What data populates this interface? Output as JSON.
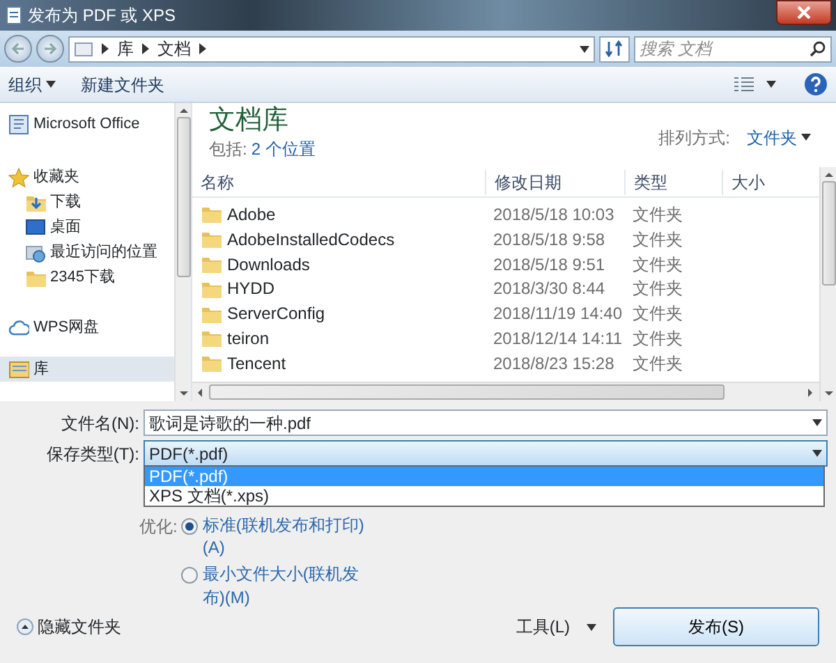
{
  "window": {
    "title": "发布为 PDF 或 XPS"
  },
  "address": {
    "breadcrumb": [
      "库",
      "文档"
    ]
  },
  "search": {
    "placeholder": "搜索 文档"
  },
  "toolbar": {
    "organize": "组织",
    "new_folder": "新建文件夹"
  },
  "nav": [
    {
      "label": "Microsoft Office",
      "kind": "office",
      "selected": false
    },
    {
      "label": "收藏夹",
      "kind": "favorites",
      "selected": false,
      "children": [
        {
          "label": "下载",
          "kind": "download",
          "selected": false
        },
        {
          "label": "桌面",
          "kind": "desktop",
          "selected": false
        },
        {
          "label": "最近访问的位置",
          "kind": "recent",
          "selected": false
        },
        {
          "label": "2345下载",
          "kind": "folder",
          "selected": false
        }
      ]
    },
    {
      "label": "WPS网盘",
      "kind": "cloud",
      "selected": false
    },
    {
      "label": "库",
      "kind": "library",
      "selected": true
    }
  ],
  "library": {
    "title": "文档库",
    "includes_label": "包括:",
    "includes_link": "2 个位置",
    "arrange_label": "排列方式:",
    "arrange_value": "文件夹"
  },
  "table": {
    "columns": [
      "名称",
      "修改日期",
      "类型",
      "大小"
    ],
    "rows": [
      {
        "name": "Adobe",
        "date": "2018/5/18 10:03",
        "type": "文件夹"
      },
      {
        "name": "AdobeInstalledCodecs",
        "date": "2018/5/18 9:58",
        "type": "文件夹"
      },
      {
        "name": "Downloads",
        "date": "2018/5/18 9:51",
        "type": "文件夹"
      },
      {
        "name": "HYDD",
        "date": "2018/3/30 8:44",
        "type": "文件夹"
      },
      {
        "name": "ServerConfig",
        "date": "2018/11/19 14:40",
        "type": "文件夹"
      },
      {
        "name": "teiron",
        "date": "2018/12/14 14:11",
        "type": "文件夹"
      },
      {
        "name": "Tencent",
        "date": "2018/8/23 15:28",
        "type": "文件夹"
      }
    ]
  },
  "form": {
    "filename_label": "文件名(N):",
    "filename": "歌词是诗歌的一种.pdf",
    "type_label": "保存类型(T):",
    "type_value": "PDF(*.pdf)",
    "type_options": [
      {
        "label": "PDF(*.pdf)",
        "selected": true
      },
      {
        "label": "XPS 文档(*.xps)",
        "selected": false
      }
    ],
    "optimize_label": "优化:",
    "optimize_options": [
      {
        "label": "标准(联机发布和打印)(A)",
        "selected": true
      },
      {
        "label": "最小文件大小(联机发布)(M)",
        "selected": false
      }
    ]
  },
  "footer": {
    "hide_folders": "隐藏文件夹",
    "tools": "工具(L)",
    "publish": "发布(S)"
  }
}
